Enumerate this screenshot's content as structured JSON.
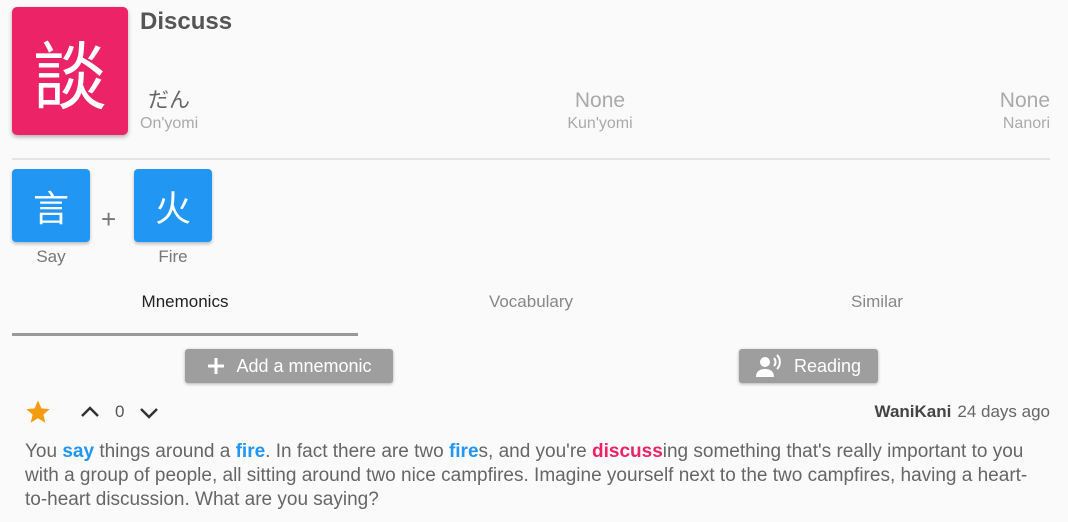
{
  "kanji": {
    "character": "談",
    "meaning": "Discuss",
    "color": "#ec2467"
  },
  "readings": {
    "onyomi": {
      "value": "だん",
      "label": "On'yomi"
    },
    "kunyomi": {
      "value": "None",
      "label": "Kun'yomi"
    },
    "nanori": {
      "value": "None",
      "label": "Nanori"
    }
  },
  "radicals": [
    {
      "character": "言",
      "label": "Say"
    },
    {
      "character": "火",
      "label": "Fire"
    }
  ],
  "plus_sign": "+",
  "radical_color": "#2196f3",
  "tabs": [
    {
      "label": "Mnemonics",
      "active": true
    },
    {
      "label": "Vocabulary",
      "active": false
    },
    {
      "label": "Similar",
      "active": false
    }
  ],
  "buttons": {
    "add_mnemonic": {
      "label": "Add a mnemonic",
      "icon": "plus-icon"
    },
    "reading": {
      "label": "Reading",
      "icon": "speaking-person-icon"
    }
  },
  "mnemonic_post": {
    "vote_count": "0",
    "author": "WaniKani",
    "time": "24 days ago",
    "star_color": "#f39c12",
    "text_parts": [
      {
        "text": "You ",
        "type": "plain"
      },
      {
        "text": "say",
        "type": "radical"
      },
      {
        "text": " things around a ",
        "type": "plain"
      },
      {
        "text": "fire",
        "type": "radical"
      },
      {
        "text": ". In fact there are two ",
        "type": "plain"
      },
      {
        "text": "fire",
        "type": "radical"
      },
      {
        "text": "s, and you're ",
        "type": "plain"
      },
      {
        "text": "discuss",
        "type": "kanji"
      },
      {
        "text": "ing something that's really important to you with a group of people, all sitting around two nice campfires. Imagine yourself next to the two campfires, having a heart-to-heart discussion. What are you saying?",
        "type": "plain"
      }
    ]
  }
}
